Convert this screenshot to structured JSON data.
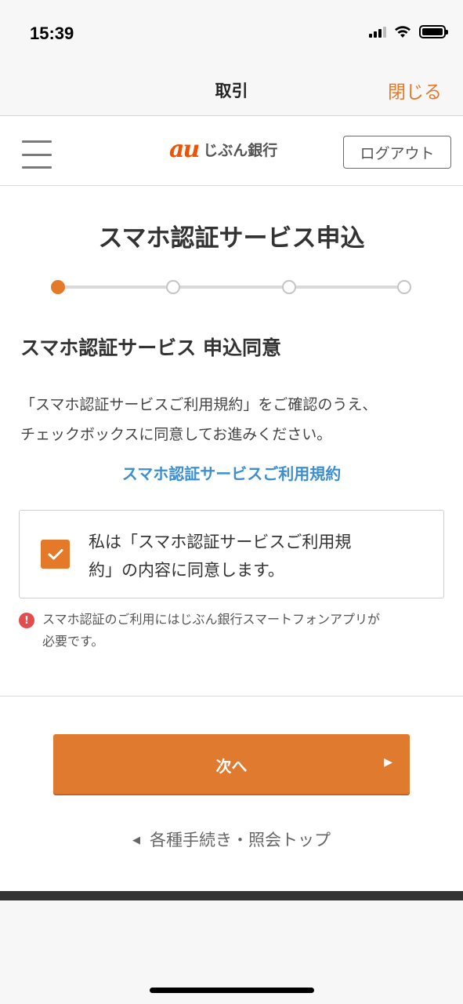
{
  "status_bar": {
    "time": "15:39"
  },
  "browser": {
    "title": "取引",
    "close_label": "閉じる"
  },
  "header": {
    "logo_au": "au",
    "logo_name": "じぶん銀行",
    "logout_label": "ログアウト"
  },
  "page": {
    "title": "スマホ認証サービス申込",
    "stepper": {
      "current_step": 1,
      "total_steps": 4
    },
    "section_title": "スマホ認証サービス 申込同意",
    "description_line1": "「スマホ認証サービスご利用規約」をご確認のうえ、",
    "description_line2": "チェックボックスに同意してお進みください。",
    "terms_link": "スマホ認証サービスご利用規約",
    "agree": {
      "checked": true,
      "line1": "私は「スマホ認証サービスご利用規",
      "line2": "約」の内容に同意します。"
    },
    "notice": {
      "icon": "!",
      "line1": "スマホ認証のご利用にはじぶん銀行スマートフォンアプリが",
      "line2": "必要です。"
    },
    "next_label": "次へ",
    "back_label": "各種手続き・照会トップ"
  },
  "colors": {
    "accent": "#e5792a",
    "link": "#3d8fd1",
    "error": "#e34c4c"
  }
}
